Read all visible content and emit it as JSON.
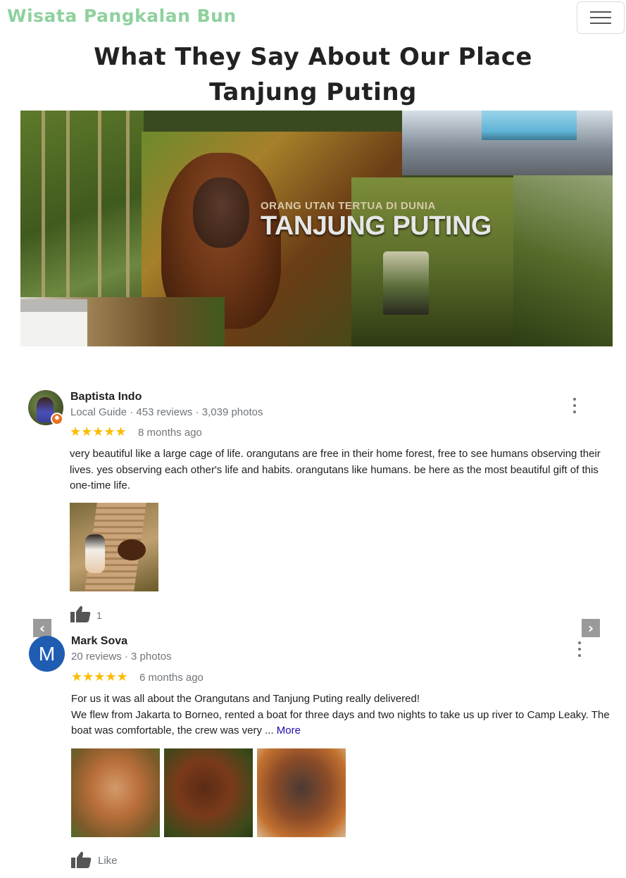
{
  "navbar": {
    "brand": "Wisata Pangkalan Bun"
  },
  "heading": {
    "line1": "What They Say About Our Place",
    "line2": "Tanjung Puting"
  },
  "banner": {
    "subtitle": "ORANG UTAN TERTUA DI DUNIA",
    "title": "TANJUNG PUTING"
  },
  "reviews": [
    {
      "name": "Baptista Indo",
      "meta": "Local Guide · 453 reviews · 3,039 photos",
      "stars": "★★★★★",
      "rating": 5,
      "date": "8 months ago",
      "text": "very beautiful like a large cage of life. orangutans are free in their home forest, free to see humans observing their lives. yes observing each other's life and habits. orangutans like humans. be here as the most beautiful gift of this one-time life.",
      "likes": "1"
    },
    {
      "avatar_letter": "M",
      "name": "Mark Sova",
      "meta": "20 reviews · 3 photos",
      "stars": "★★★★★",
      "rating": 5,
      "date": "6 months ago",
      "text_line1": "For us it was all about the Orangutans and Tanjung Puting really delivered!",
      "text_line2": "We flew from Jakarta to Borneo, rented a boat for three days and two nights to take us up river to Camp Leaky. The boat was comfortable, the crew was very ...",
      "more": "More",
      "like_label": "Like"
    }
  ],
  "carousel": {
    "prev_glyph": "‹",
    "next_glyph": "›"
  },
  "icons": {
    "menu": "hamburger-icon",
    "more": "kebab-menu-icon",
    "like": "thumbs-up-icon",
    "guide": "local-guide-badge-icon"
  },
  "colors": {
    "brand": "#8fd19e",
    "star": "#fbbc04",
    "link": "#1a0dab",
    "avatar_bg": "#1f5db3"
  }
}
